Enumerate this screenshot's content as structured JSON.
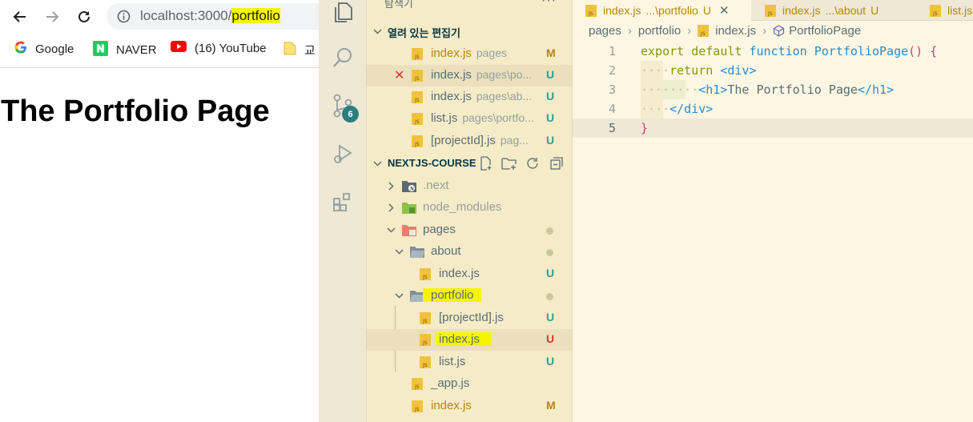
{
  "browser": {
    "url_host": "localhost:3000/",
    "url_path": "portfolio",
    "bookmarks": [
      {
        "label": "Google",
        "icon": "google-icon"
      },
      {
        "label": "NAVER",
        "icon": "naver-icon"
      },
      {
        "label": "(16) YouTube",
        "icon": "youtube-icon"
      },
      {
        "label": "교",
        "icon": "folder-icon"
      }
    ],
    "page_heading": "The Portfolio Page"
  },
  "vscode": {
    "activity_badge": "6",
    "explorer_title": "탐색기",
    "open_editors_title": "열려 있는 편집기",
    "open_editors": [
      {
        "name": "index.js",
        "desc": "pages",
        "status": "M"
      },
      {
        "name": "index.js",
        "desc": "pages\\po...",
        "status": "U"
      },
      {
        "name": "index.js",
        "desc": "pages\\ab...",
        "status": "U"
      },
      {
        "name": "list.js",
        "desc": "pages\\portfo...",
        "status": "U"
      },
      {
        "name": "[projectId].js",
        "desc": "pag...",
        "status": "U"
      }
    ],
    "project_title": "NEXTJS-COURSE",
    "tree": {
      "next": ".next",
      "node_modules": "node_modules",
      "pages": "pages",
      "about": "about",
      "about_index": "index.js",
      "about_index_status": "U",
      "portfolio": "portfolio",
      "projectid": "[projectId].js",
      "projectid_status": "U",
      "portfolio_index": "index.js",
      "portfolio_index_status": "U",
      "list": "list.js",
      "list_status": "U",
      "app": "_app.js",
      "root_index": "index.js",
      "root_index_status": "M"
    },
    "tabs": [
      {
        "name": "index.js",
        "desc": "...\\portfolio",
        "status": "U"
      },
      {
        "name": "index.js",
        "desc": "...\\about",
        "status": "U"
      },
      {
        "name": "list.js",
        "desc": "",
        "status": ""
      }
    ],
    "breadcrumb": [
      "pages",
      "portfolio",
      "index.js",
      "PortfolioPage"
    ],
    "code": {
      "line_numbers": [
        "1",
        "2",
        "3",
        "4",
        "5"
      ],
      "l1_kw1": "export",
      "l1_kw2": "default",
      "l1_kw3": "function",
      "l1_fn": "PortfolioPage",
      "l1_paren": "()",
      "l1_brace": "{",
      "l2_kw": "return",
      "l2_tag": "<div>",
      "l3_open": "<h1>",
      "l3_text": "The Portfolio Page",
      "l3_close": "</h1>",
      "l4_tag": "</div>",
      "l5_brace": "}"
    },
    "colors": {
      "accent_badge": "#2d7e7e",
      "highlight": "#f5f500"
    }
  }
}
